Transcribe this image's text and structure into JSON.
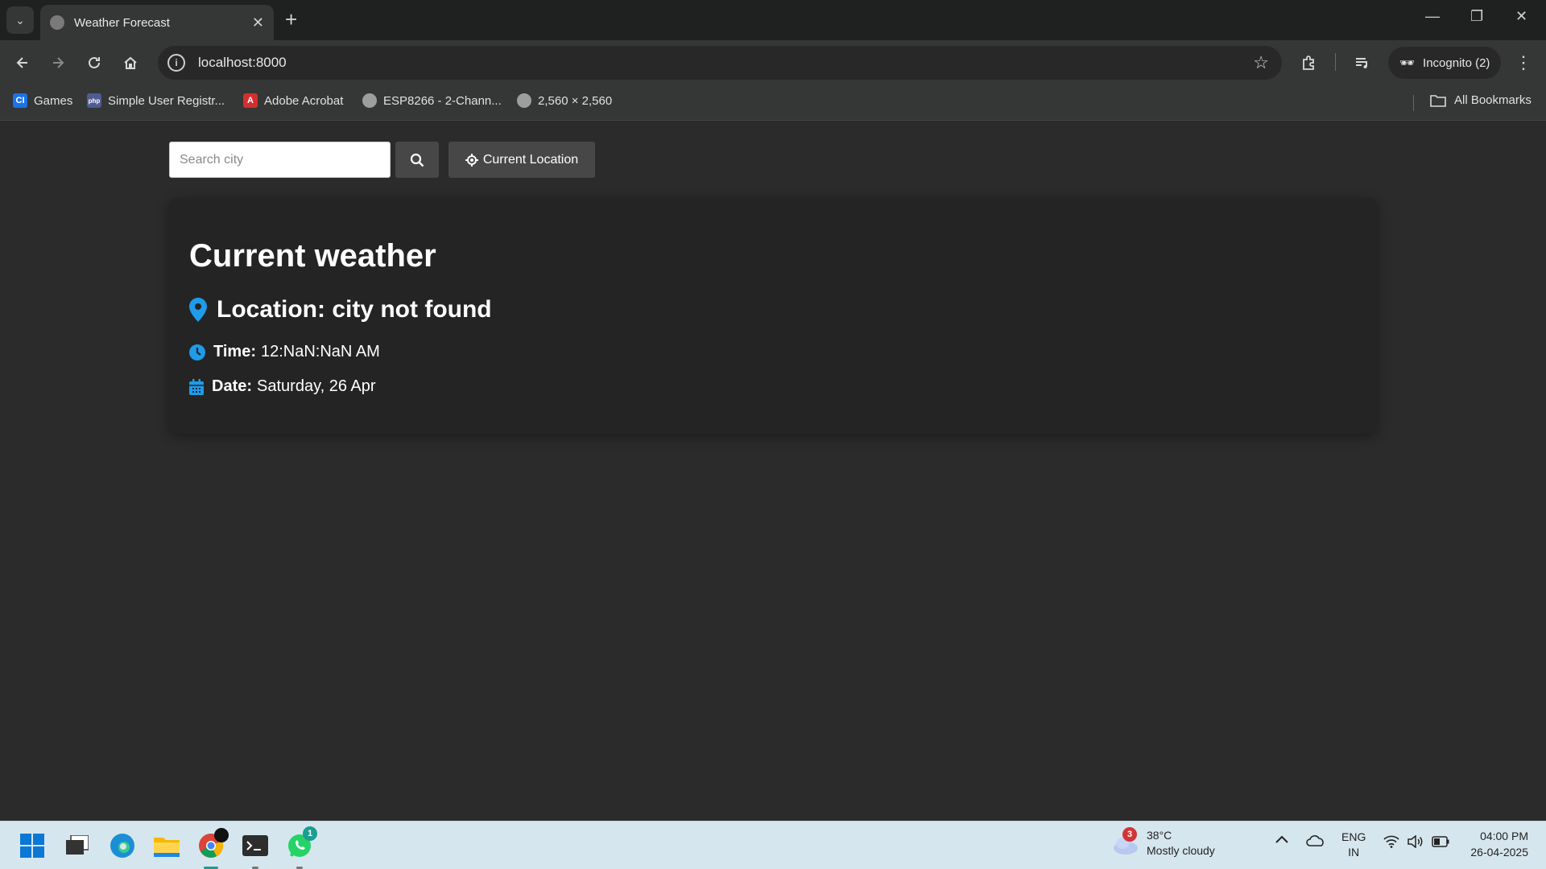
{
  "browser": {
    "tab_title": "Weather Forecast",
    "tab_close": "✕",
    "new_tab": "+",
    "url": "localhost:8000",
    "profile_label": "Incognito (2)",
    "window_controls": {
      "minimize": "—",
      "restore": "❐",
      "close": "✕"
    },
    "bookmarks": [
      {
        "label": "Games",
        "icon": "cl-icon",
        "color": "#1a73e8"
      },
      {
        "label": "Simple User Registr...",
        "icon": "php-icon",
        "color": "#4f5b93"
      },
      {
        "label": "Adobe Acrobat",
        "icon": "acrobat-icon",
        "color": "#d32f2f"
      },
      {
        "label": "ESP8266 - 2-Chann...",
        "icon": "globe-icon",
        "color": "#9e9e9e"
      },
      {
        "label": "2,560 × 2,560",
        "icon": "globe-icon",
        "color": "#9e9e9e"
      }
    ],
    "all_bookmarks": "All Bookmarks"
  },
  "search": {
    "placeholder": "Search city",
    "current_location_label": "Current Location"
  },
  "weather": {
    "heading": "Current weather",
    "location": "Location: city not found",
    "time_label": "Time:",
    "time_value": "12:NaN:NaN AM",
    "date_label": "Date:",
    "date_value": "Saturday, 26 Apr"
  },
  "taskbar": {
    "weather_badge": "3",
    "weather_temp": "38°C",
    "weather_desc": "Mostly cloudy",
    "whatsapp_badge": "1",
    "lang_top": "ENG",
    "lang_bottom": "IN",
    "time": "04:00 PM",
    "date": "26-04-2025"
  },
  "colors": {
    "accent": "#1e9be9",
    "page_bg": "#2b2b2b",
    "card_bg": "#242424"
  }
}
